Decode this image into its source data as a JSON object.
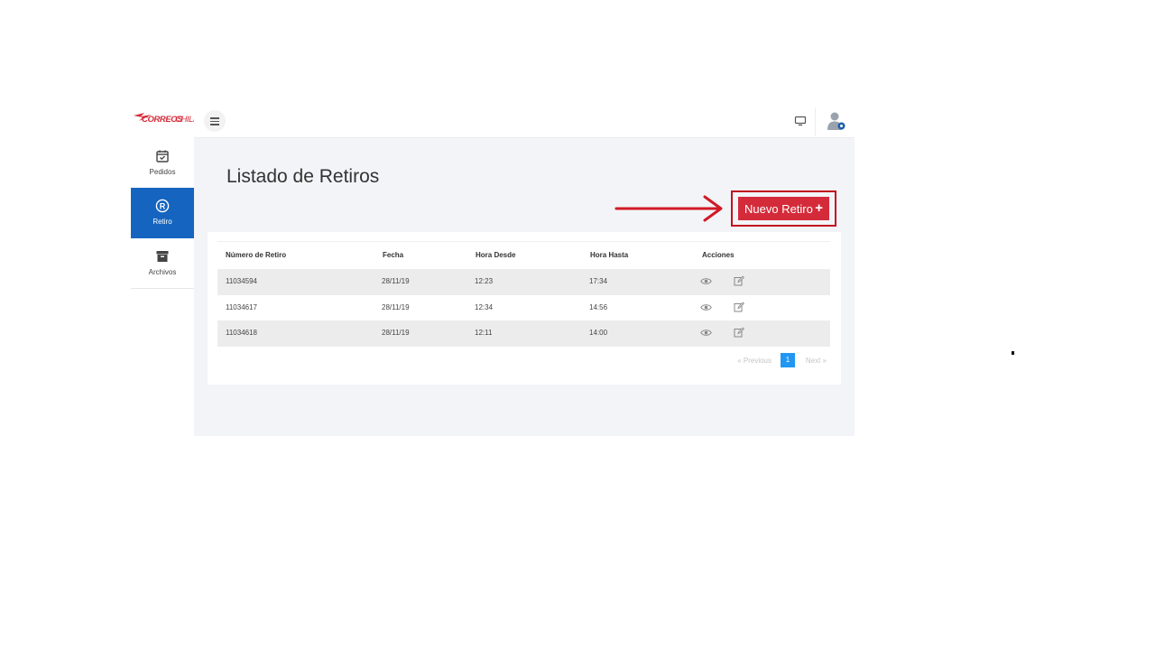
{
  "brand": {
    "logo_text": "CORREOSCHILE",
    "color": "#d42b3a"
  },
  "sidebar": {
    "items": [
      {
        "label": "Pedidos",
        "icon": "calendar-check-icon",
        "active": false
      },
      {
        "label": "Retiro",
        "icon": "registered-icon",
        "active": true
      },
      {
        "label": "Archivos",
        "icon": "archive-box-icon",
        "active": false
      }
    ],
    "active_color": "#1565c0"
  },
  "topbar": {
    "menu_icon": "hamburger-icon",
    "screen_icon": "monitor-icon",
    "user_icon": "user-avatar-icon"
  },
  "page": {
    "title": "Listado de Retiros",
    "new_button": {
      "label": "Nuevo Retiro",
      "icon": "plus-icon",
      "color": "#d42b3a"
    }
  },
  "annotation": {
    "arrow_color": "#d01a26",
    "highlight_color": "#c1121f"
  },
  "table": {
    "columns": [
      "Número de Retiro",
      "Fecha",
      "Hora Desde",
      "Hora Hasta",
      "Acciones"
    ],
    "rows": [
      [
        "11034594",
        "28/11/19",
        "12:23",
        "17:34"
      ],
      [
        "11034617",
        "28/11/19",
        "12:34",
        "14:56"
      ],
      [
        "11034618",
        "28/11/19",
        "12:11",
        "14:00"
      ]
    ],
    "row_actions": [
      "eye-icon",
      "edit-icon"
    ]
  },
  "pagination": {
    "previous": "«  Previous",
    "current": "1",
    "next": "Next  »",
    "accent": "#2196f3"
  }
}
